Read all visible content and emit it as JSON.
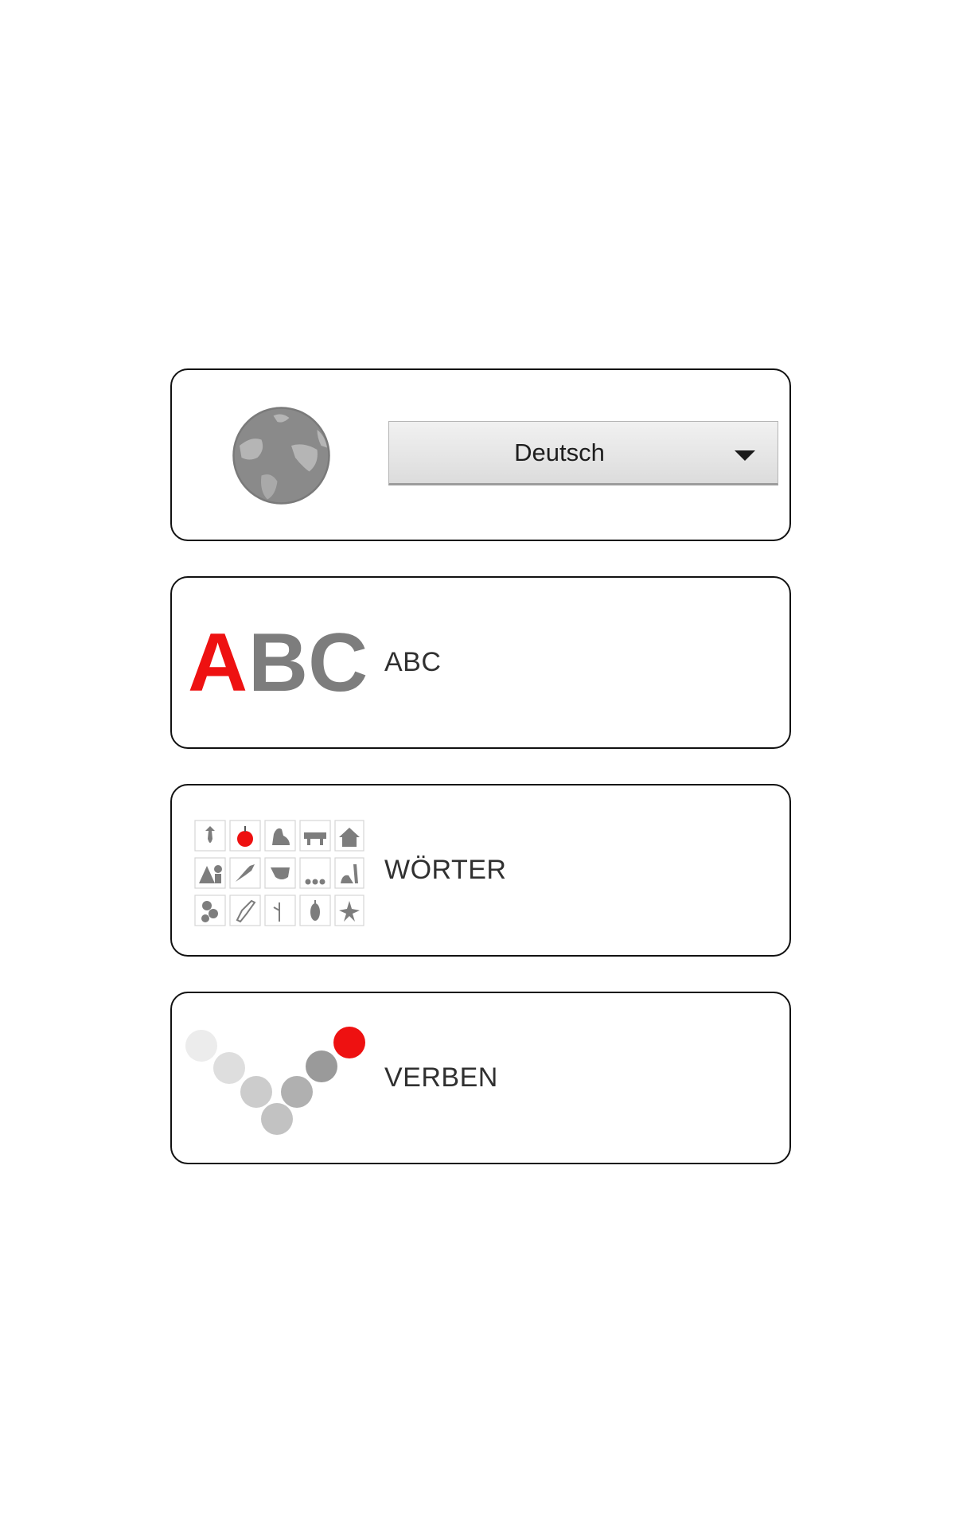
{
  "language": {
    "selected": "Deutsch",
    "icon": "globe-icon"
  },
  "menu": [
    {
      "id": "abc",
      "label": "ABC",
      "icon": "abc-logo-icon"
    },
    {
      "id": "woerter",
      "label": "WÖRTER",
      "icon": "pictogram-grid-icon"
    },
    {
      "id": "verben",
      "label": "VERBEN",
      "icon": "verb-dots-icon"
    }
  ],
  "colors": {
    "accent_red": "#ee1111",
    "icon_gray": "#7d7d7d",
    "border": "#111111"
  },
  "logo": {
    "abc_text": "ABC"
  }
}
